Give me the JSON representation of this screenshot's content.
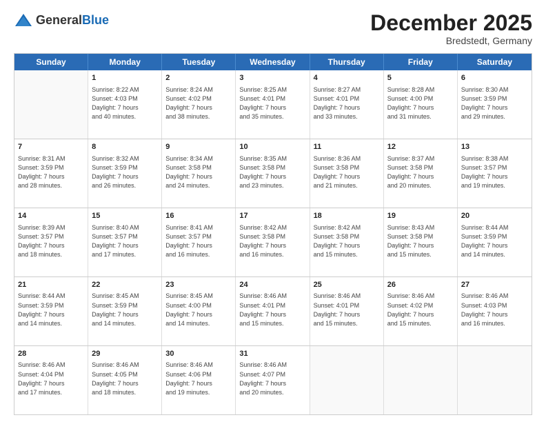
{
  "logo": {
    "general": "General",
    "blue": "Blue"
  },
  "title": "December 2025",
  "location": "Bredstedt, Germany",
  "header_days": [
    "Sunday",
    "Monday",
    "Tuesday",
    "Wednesday",
    "Thursday",
    "Friday",
    "Saturday"
  ],
  "weeks": [
    [
      {
        "day": "",
        "info": ""
      },
      {
        "day": "1",
        "info": "Sunrise: 8:22 AM\nSunset: 4:03 PM\nDaylight: 7 hours\nand 40 minutes."
      },
      {
        "day": "2",
        "info": "Sunrise: 8:24 AM\nSunset: 4:02 PM\nDaylight: 7 hours\nand 38 minutes."
      },
      {
        "day": "3",
        "info": "Sunrise: 8:25 AM\nSunset: 4:01 PM\nDaylight: 7 hours\nand 35 minutes."
      },
      {
        "day": "4",
        "info": "Sunrise: 8:27 AM\nSunset: 4:01 PM\nDaylight: 7 hours\nand 33 minutes."
      },
      {
        "day": "5",
        "info": "Sunrise: 8:28 AM\nSunset: 4:00 PM\nDaylight: 7 hours\nand 31 minutes."
      },
      {
        "day": "6",
        "info": "Sunrise: 8:30 AM\nSunset: 3:59 PM\nDaylight: 7 hours\nand 29 minutes."
      }
    ],
    [
      {
        "day": "7",
        "info": "Sunrise: 8:31 AM\nSunset: 3:59 PM\nDaylight: 7 hours\nand 28 minutes."
      },
      {
        "day": "8",
        "info": "Sunrise: 8:32 AM\nSunset: 3:59 PM\nDaylight: 7 hours\nand 26 minutes."
      },
      {
        "day": "9",
        "info": "Sunrise: 8:34 AM\nSunset: 3:58 PM\nDaylight: 7 hours\nand 24 minutes."
      },
      {
        "day": "10",
        "info": "Sunrise: 8:35 AM\nSunset: 3:58 PM\nDaylight: 7 hours\nand 23 minutes."
      },
      {
        "day": "11",
        "info": "Sunrise: 8:36 AM\nSunset: 3:58 PM\nDaylight: 7 hours\nand 21 minutes."
      },
      {
        "day": "12",
        "info": "Sunrise: 8:37 AM\nSunset: 3:58 PM\nDaylight: 7 hours\nand 20 minutes."
      },
      {
        "day": "13",
        "info": "Sunrise: 8:38 AM\nSunset: 3:57 PM\nDaylight: 7 hours\nand 19 minutes."
      }
    ],
    [
      {
        "day": "14",
        "info": "Sunrise: 8:39 AM\nSunset: 3:57 PM\nDaylight: 7 hours\nand 18 minutes."
      },
      {
        "day": "15",
        "info": "Sunrise: 8:40 AM\nSunset: 3:57 PM\nDaylight: 7 hours\nand 17 minutes."
      },
      {
        "day": "16",
        "info": "Sunrise: 8:41 AM\nSunset: 3:57 PM\nDaylight: 7 hours\nand 16 minutes."
      },
      {
        "day": "17",
        "info": "Sunrise: 8:42 AM\nSunset: 3:58 PM\nDaylight: 7 hours\nand 16 minutes."
      },
      {
        "day": "18",
        "info": "Sunrise: 8:42 AM\nSunset: 3:58 PM\nDaylight: 7 hours\nand 15 minutes."
      },
      {
        "day": "19",
        "info": "Sunrise: 8:43 AM\nSunset: 3:58 PM\nDaylight: 7 hours\nand 15 minutes."
      },
      {
        "day": "20",
        "info": "Sunrise: 8:44 AM\nSunset: 3:59 PM\nDaylight: 7 hours\nand 14 minutes."
      }
    ],
    [
      {
        "day": "21",
        "info": "Sunrise: 8:44 AM\nSunset: 3:59 PM\nDaylight: 7 hours\nand 14 minutes."
      },
      {
        "day": "22",
        "info": "Sunrise: 8:45 AM\nSunset: 3:59 PM\nDaylight: 7 hours\nand 14 minutes."
      },
      {
        "day": "23",
        "info": "Sunrise: 8:45 AM\nSunset: 4:00 PM\nDaylight: 7 hours\nand 14 minutes."
      },
      {
        "day": "24",
        "info": "Sunrise: 8:46 AM\nSunset: 4:01 PM\nDaylight: 7 hours\nand 15 minutes."
      },
      {
        "day": "25",
        "info": "Sunrise: 8:46 AM\nSunset: 4:01 PM\nDaylight: 7 hours\nand 15 minutes."
      },
      {
        "day": "26",
        "info": "Sunrise: 8:46 AM\nSunset: 4:02 PM\nDaylight: 7 hours\nand 15 minutes."
      },
      {
        "day": "27",
        "info": "Sunrise: 8:46 AM\nSunset: 4:03 PM\nDaylight: 7 hours\nand 16 minutes."
      }
    ],
    [
      {
        "day": "28",
        "info": "Sunrise: 8:46 AM\nSunset: 4:04 PM\nDaylight: 7 hours\nand 17 minutes."
      },
      {
        "day": "29",
        "info": "Sunrise: 8:46 AM\nSunset: 4:05 PM\nDaylight: 7 hours\nand 18 minutes."
      },
      {
        "day": "30",
        "info": "Sunrise: 8:46 AM\nSunset: 4:06 PM\nDaylight: 7 hours\nand 19 minutes."
      },
      {
        "day": "31",
        "info": "Sunrise: 8:46 AM\nSunset: 4:07 PM\nDaylight: 7 hours\nand 20 minutes."
      },
      {
        "day": "",
        "info": ""
      },
      {
        "day": "",
        "info": ""
      },
      {
        "day": "",
        "info": ""
      }
    ]
  ]
}
